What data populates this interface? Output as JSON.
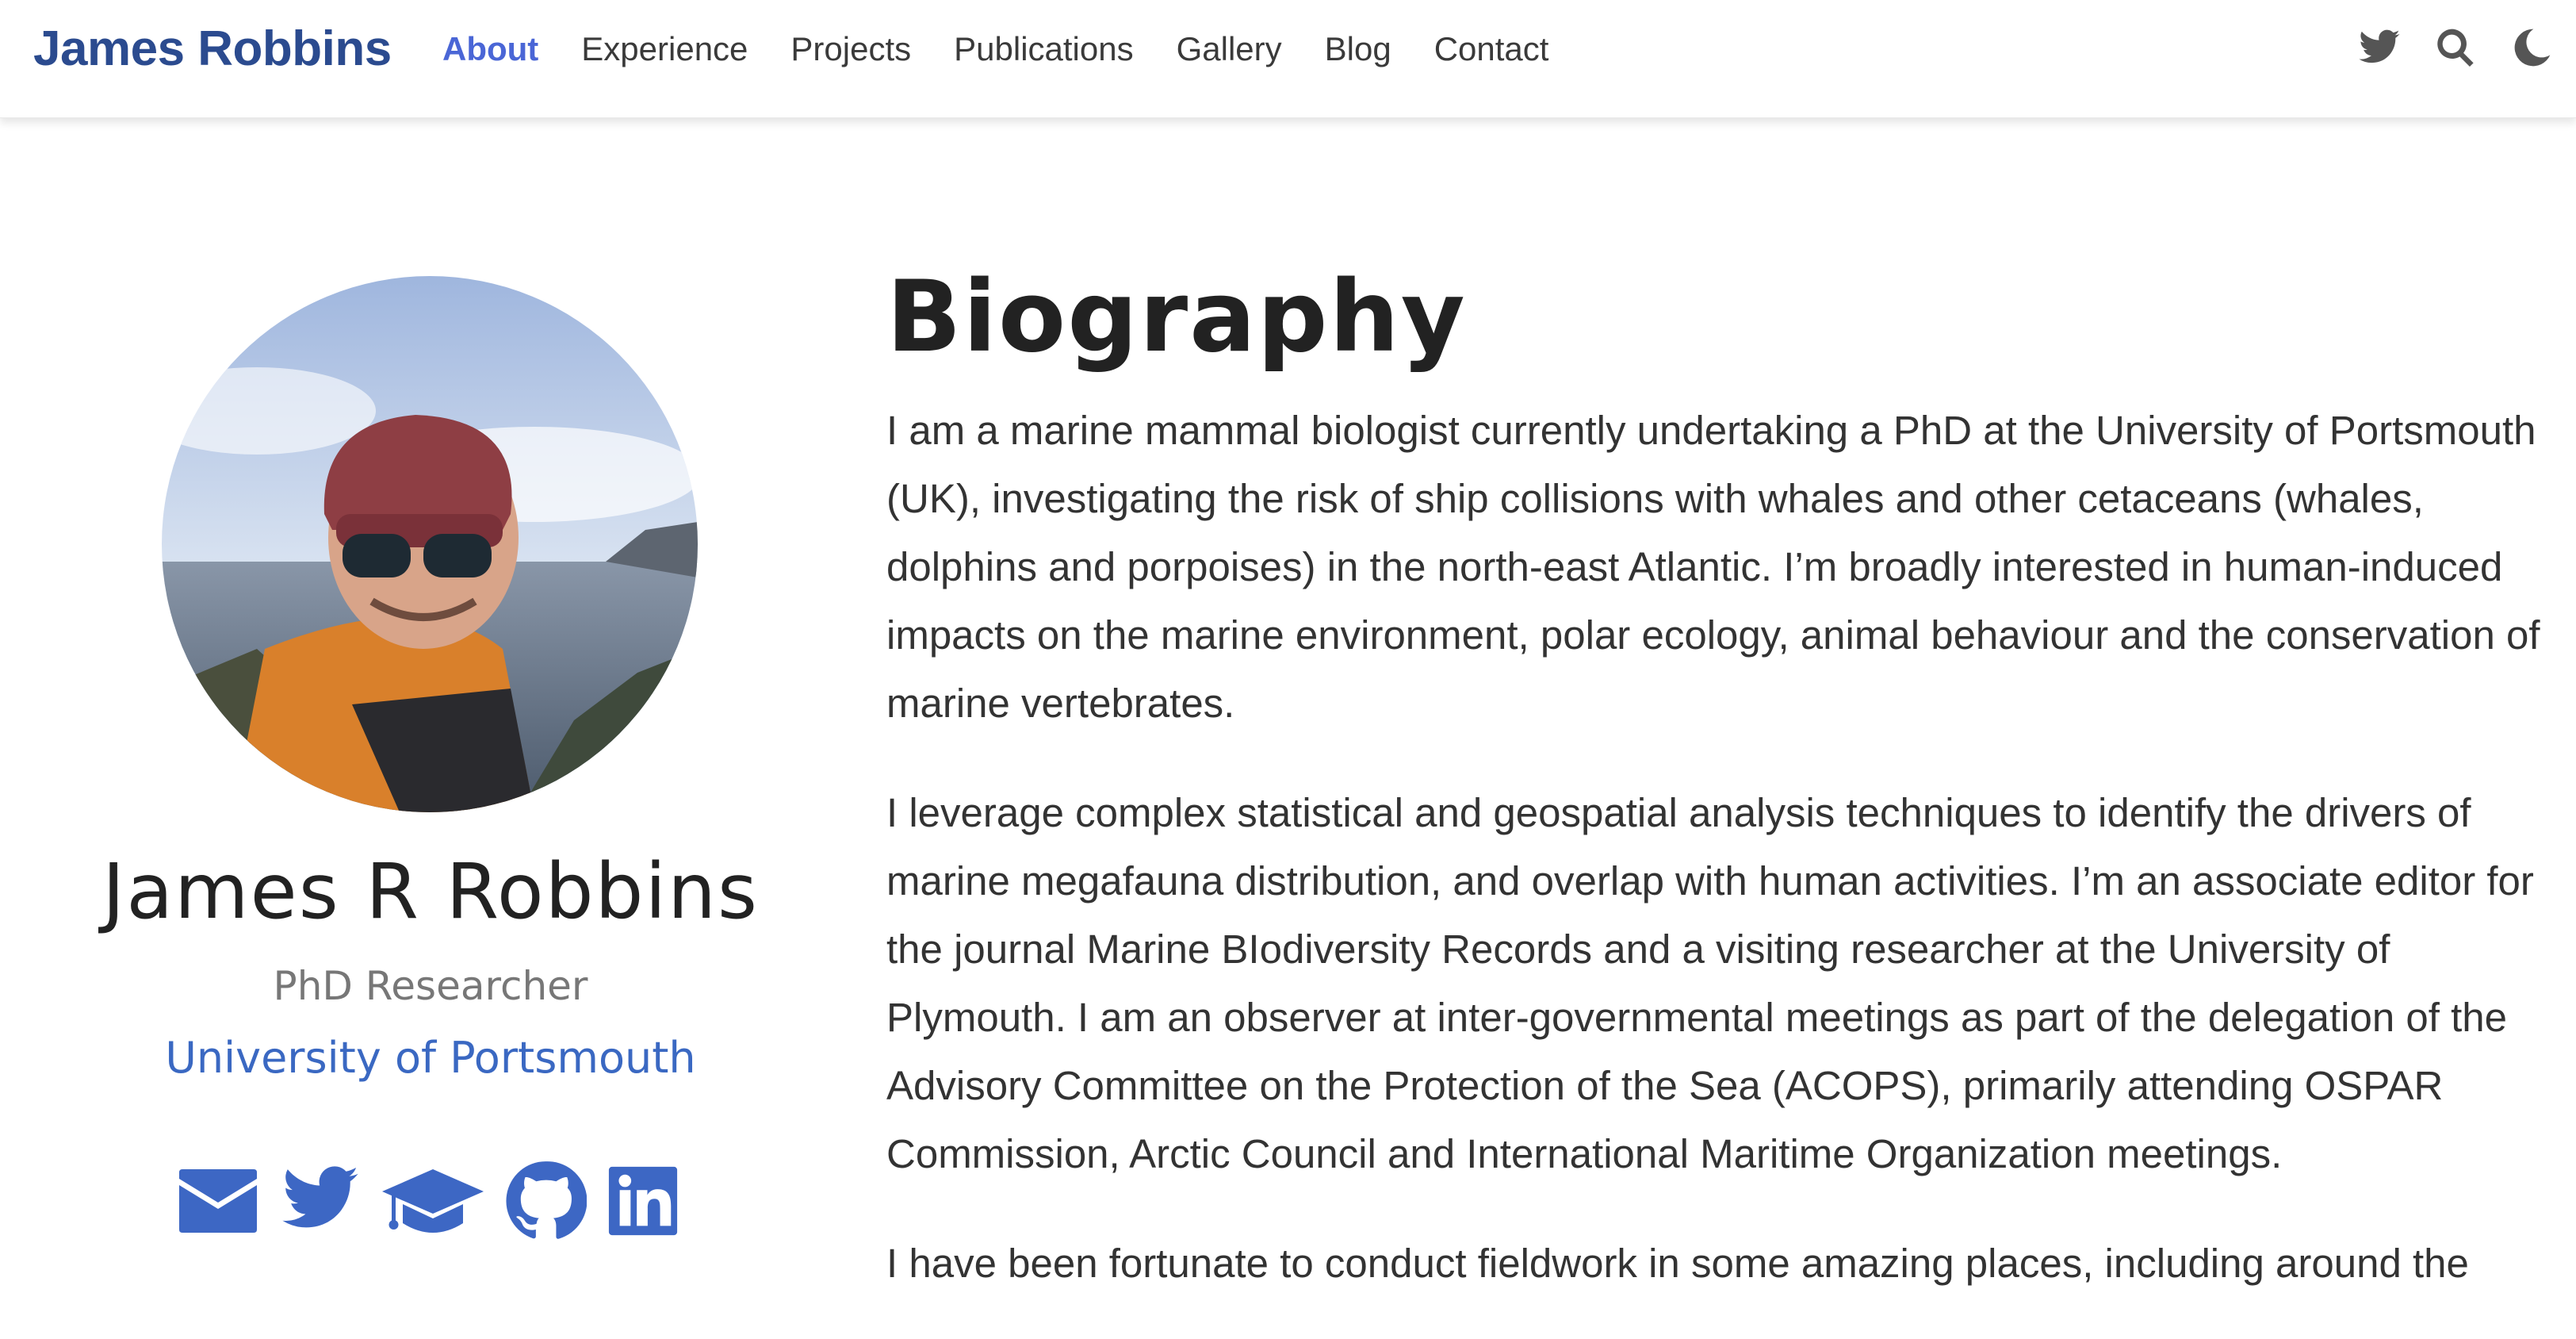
{
  "brand": "James Robbins",
  "nav": {
    "items": [
      {
        "label": "About",
        "active": true
      },
      {
        "label": "Experience"
      },
      {
        "label": "Projects"
      },
      {
        "label": "Publications"
      },
      {
        "label": "Gallery"
      },
      {
        "label": "Blog"
      },
      {
        "label": "Contact"
      }
    ],
    "icons": [
      "twitter-icon",
      "search-icon",
      "moon-icon"
    ]
  },
  "profile": {
    "name": "James R Robbins",
    "role": "PhD Researcher",
    "organization": "University of Portsmouth",
    "social_icons": [
      "envelope-icon",
      "twitter-icon",
      "graduation-cap-icon",
      "github-icon",
      "linkedin-icon"
    ]
  },
  "biography": {
    "title": "Biography",
    "paragraphs": [
      "I am a marine mammal biologist currently undertaking a PhD at the University of Portsmouth (UK), investigating the risk of ship collisions with whales and other cetaceans (whales, dolphins and porpoises) in the north-east Atlantic. I’m broadly interested in human-induced impacts on the marine environment, polar ecology, animal behaviour and the conservation of marine vertebrates.",
      "I leverage complex statistical and geospatial analysis techniques to identify the drivers of marine megafauna distribution, and overlap with human activities. I’m an associate editor for the journal Marine BIodiversity Records and a visiting researcher at the University of Plymouth. I am an observer at inter-governmental meetings as part of the delegation of the Advisory Committee on the Protection of the Sea (ACOPS), primarily attending OSPAR Commission, Arctic Council and International Maritime Organization meetings.",
      "I have been fortunate to conduct fieldwork in some amazing places, including around the"
    ]
  },
  "colors": {
    "brand": "#2b4b8f",
    "nav_active": "#4a66d6",
    "accent": "#3d67c4",
    "text": "#333333"
  }
}
